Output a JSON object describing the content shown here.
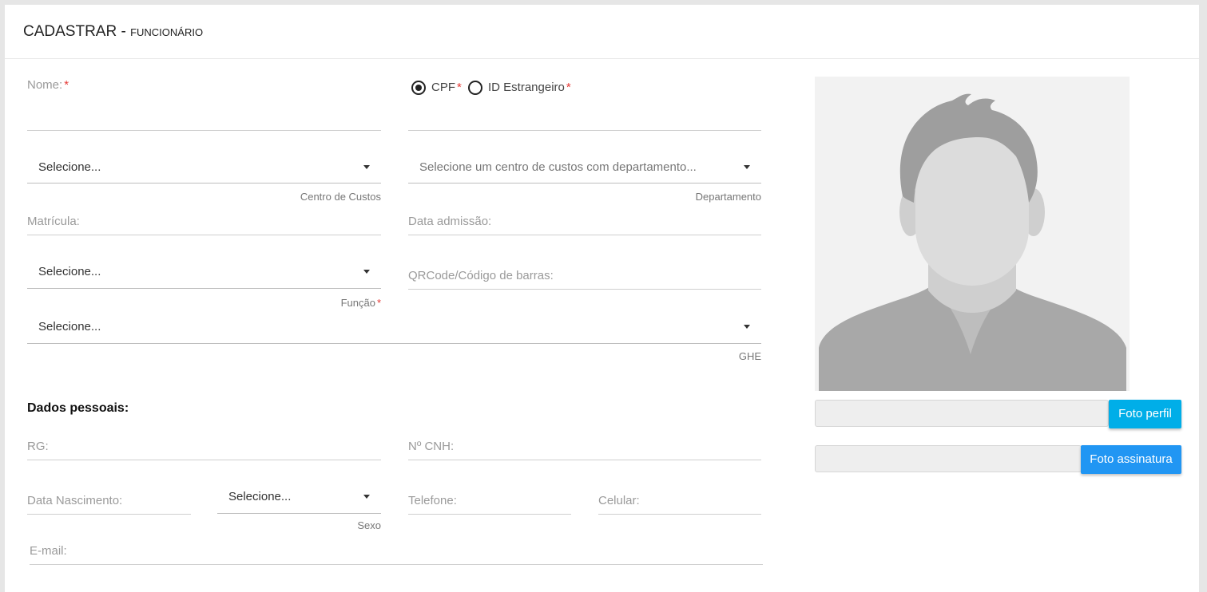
{
  "header": {
    "title_main": "CADASTRAR - ",
    "title_sub": "FUNCIONÁRIO"
  },
  "form": {
    "nome_label": "Nome:",
    "required_mark": "*",
    "doc_type": {
      "options": [
        "CPF",
        "ID Estrangeiro"
      ],
      "selected": "CPF"
    },
    "centro_custos": {
      "value": "Selecione...",
      "helper": "Centro de Custos"
    },
    "departamento": {
      "value": "Selecione um centro de custos com departamento...",
      "helper": "Departamento"
    },
    "matricula_label": "Matrícula:",
    "data_admissao_label": "Data admissão:",
    "funcao": {
      "value": "Selecione...",
      "helper": "Função"
    },
    "qrcode_label": "QRCode/Código de barras:",
    "ghe": {
      "value": "Selecione...",
      "helper": "GHE"
    },
    "dados_pessoais_heading": "Dados pessoais:",
    "rg_label": "RG:",
    "cnh_label": "Nº CNH:",
    "data_nascimento_label": "Data Nascimento:",
    "sexo": {
      "value": "Selecione...",
      "helper": "Sexo"
    },
    "telefone_label": "Telefone:",
    "celular_label": "Celular:",
    "email_label": "E-mail:"
  },
  "photo_panel": {
    "foto_perfil_button": "Foto perfil",
    "foto_assinatura_button": "Foto assinatura"
  },
  "colors": {
    "required": "#e53935",
    "button_cyan": "#00aee8",
    "button_blue": "#2196f3"
  }
}
